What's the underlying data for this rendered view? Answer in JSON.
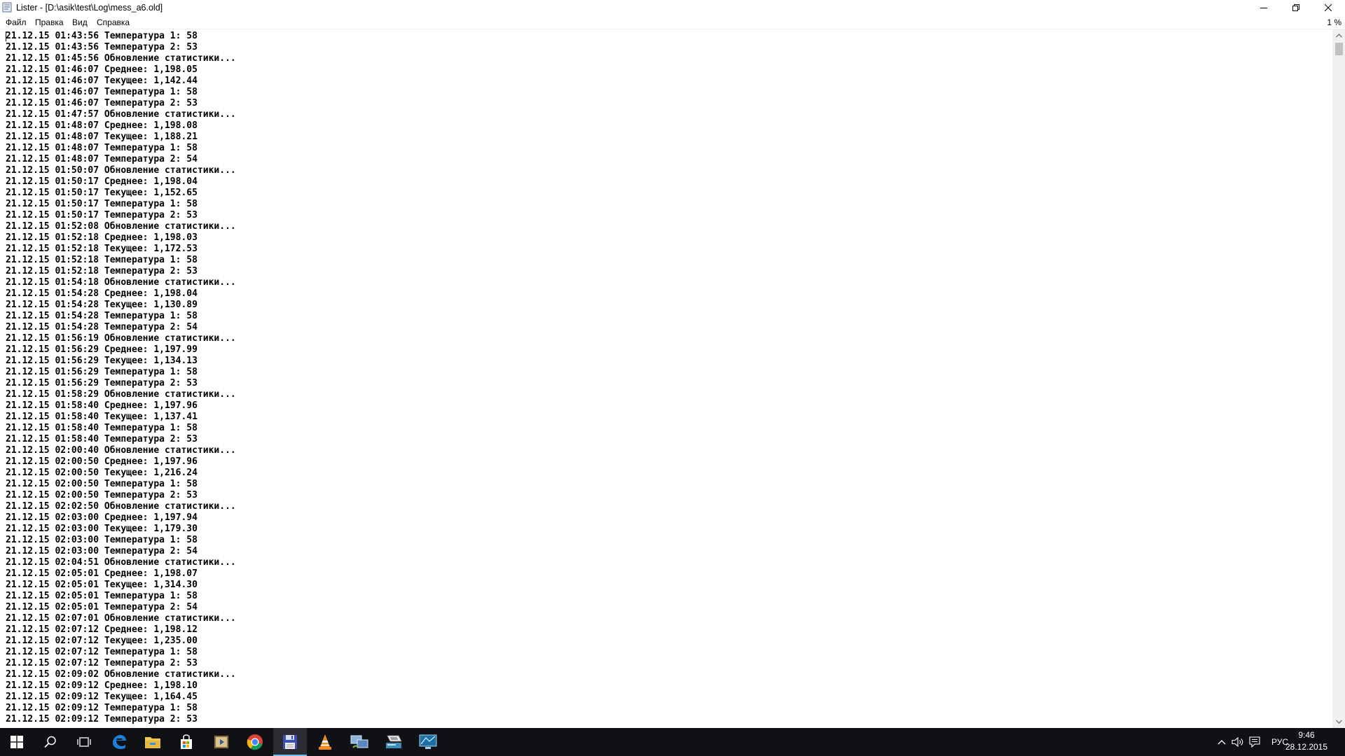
{
  "window": {
    "title": "Lister - [D:\\asik\\test\\Log\\mess_a6.old]"
  },
  "menu": {
    "file": "Файл",
    "edit": "Правка",
    "view": "Вид",
    "help": "Справка",
    "percent": "1 %"
  },
  "lines": [
    "21.12.15 01:43:56 Температура 1: 58",
    "21.12.15 01:43:56 Температура 2: 53",
    "21.12.15 01:45:56 Обновление статистики...",
    "21.12.15 01:46:07 Среднее: 1,198.05",
    "21.12.15 01:46:07 Текущее: 1,142.44",
    "21.12.15 01:46:07 Температура 1: 58",
    "21.12.15 01:46:07 Температура 2: 53",
    "21.12.15 01:47:57 Обновление статистики...",
    "21.12.15 01:48:07 Среднее: 1,198.08",
    "21.12.15 01:48:07 Текущее: 1,188.21",
    "21.12.15 01:48:07 Температура 1: 58",
    "21.12.15 01:48:07 Температура 2: 54",
    "21.12.15 01:50:07 Обновление статистики...",
    "21.12.15 01:50:17 Среднее: 1,198.04",
    "21.12.15 01:50:17 Текущее: 1,152.65",
    "21.12.15 01:50:17 Температура 1: 58",
    "21.12.15 01:50:17 Температура 2: 53",
    "21.12.15 01:52:08 Обновление статистики...",
    "21.12.15 01:52:18 Среднее: 1,198.03",
    "21.12.15 01:52:18 Текущее: 1,172.53",
    "21.12.15 01:52:18 Температура 1: 58",
    "21.12.15 01:52:18 Температура 2: 53",
    "21.12.15 01:54:18 Обновление статистики...",
    "21.12.15 01:54:28 Среднее: 1,198.04",
    "21.12.15 01:54:28 Текущее: 1,130.89",
    "21.12.15 01:54:28 Температура 1: 58",
    "21.12.15 01:54:28 Температура 2: 54",
    "21.12.15 01:56:19 Обновление статистики...",
    "21.12.15 01:56:29 Среднее: 1,197.99",
    "21.12.15 01:56:29 Текущее: 1,134.13",
    "21.12.15 01:56:29 Температура 1: 58",
    "21.12.15 01:56:29 Температура 2: 53",
    "21.12.15 01:58:29 Обновление статистики...",
    "21.12.15 01:58:40 Среднее: 1,197.96",
    "21.12.15 01:58:40 Текущее: 1,137.41",
    "21.12.15 01:58:40 Температура 1: 58",
    "21.12.15 01:58:40 Температура 2: 53",
    "21.12.15 02:00:40 Обновление статистики...",
    "21.12.15 02:00:50 Среднее: 1,197.96",
    "21.12.15 02:00:50 Текущее: 1,216.24",
    "21.12.15 02:00:50 Температура 1: 58",
    "21.12.15 02:00:50 Температура 2: 53",
    "21.12.15 02:02:50 Обновление статистики...",
    "21.12.15 02:03:00 Среднее: 1,197.94",
    "21.12.15 02:03:00 Текущее: 1,179.30",
    "21.12.15 02:03:00 Температура 1: 58",
    "21.12.15 02:03:00 Температура 2: 54",
    "21.12.15 02:04:51 Обновление статистики...",
    "21.12.15 02:05:01 Среднее: 1,198.07",
    "21.12.15 02:05:01 Текущее: 1,314.30",
    "21.12.15 02:05:01 Температура 1: 58",
    "21.12.15 02:05:01 Температура 2: 54",
    "21.12.15 02:07:01 Обновление статистики...",
    "21.12.15 02:07:12 Среднее: 1,198.12",
    "21.12.15 02:07:12 Текущее: 1,235.00",
    "21.12.15 02:07:12 Температура 1: 58",
    "21.12.15 02:07:12 Температура 2: 53",
    "21.12.15 02:09:02 Обновление статистики...",
    "21.12.15 02:09:12 Среднее: 1,198.10",
    "21.12.15 02:09:12 Текущее: 1,164.45",
    "21.12.15 02:09:12 Температура 1: 58",
    "21.12.15 02:09:12 Температура 2: 53"
  ],
  "taskbar": {
    "language": "РУС",
    "time": "9:46",
    "date": "28.12.2015",
    "apps": [
      "start-icon",
      "search-icon",
      "task-view-icon",
      "edge-icon",
      "file-explorer-icon",
      "store-icon",
      "media-player-icon",
      "chrome-icon",
      "floppy-disk-icon",
      "vlc-icon",
      "remote-desktop-icon",
      "scanner-icon",
      "monitor-app-icon"
    ]
  },
  "colors": {
    "taskbar_bg": "#101114",
    "taskbar_active_underline": "#76b9ed",
    "edge_blue": "#1e7fd6",
    "explorer_yellow": "#f2c94c",
    "vlc_orange": "#f28a1e"
  }
}
